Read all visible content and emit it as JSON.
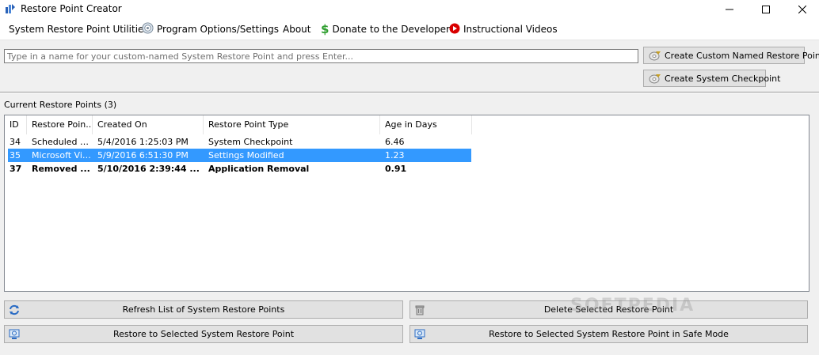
{
  "window": {
    "title": "Restore Point Creator",
    "minimize_glyph": "—",
    "maximize_glyph": "☐",
    "close_glyph": "✕"
  },
  "menu": {
    "items": [
      {
        "label": "System Restore Point Utilities",
        "icon": ""
      },
      {
        "label": "Program Options/Settings",
        "icon": "gear-icon"
      },
      {
        "label": "About",
        "icon": ""
      },
      {
        "label": "Donate to the Developer",
        "icon": "dollar-icon"
      },
      {
        "label": "Instructional Videos",
        "icon": "play-icon"
      }
    ]
  },
  "create": {
    "input_placeholder": "Type in a name for your custom-named System Restore Point and press Enter...",
    "input_value": "",
    "custom_button": "Create Custom Named Restore Point",
    "checkpoint_button": "Create System Checkpoint"
  },
  "restore_points": {
    "label": "Current Restore Points (3)",
    "columns": [
      "ID",
      "Restore Poin...",
      "Created On",
      "Restore Point Type",
      "Age in Days"
    ],
    "rows": [
      {
        "id": "34",
        "name": "Scheduled C...",
        "created": "5/4/2016 1:25:03 PM",
        "type": "System Checkpoint",
        "age": "6.46",
        "selected": false,
        "bold": false
      },
      {
        "id": "35",
        "name": "Microsoft Vis...",
        "created": "5/9/2016 6:51:30 PM",
        "type": "Settings Modified",
        "age": "1.23",
        "selected": true,
        "bold": false
      },
      {
        "id": "37",
        "name": "Removed ...",
        "created": "5/10/2016 2:39:44 ...",
        "type": "Application Removal",
        "age": "0.91",
        "selected": false,
        "bold": true
      }
    ]
  },
  "actions": {
    "refresh": "Refresh List of System Restore Points",
    "delete": "Delete Selected Restore Point",
    "restore": "Restore to Selected System Restore Point",
    "restore_safe": "Restore to Selected System Restore Point in Safe Mode"
  },
  "watermark": "SOFTPEDIA",
  "colors": {
    "selection": "#3399ff",
    "donate_green": "#2e9e2e",
    "video_red": "#d90000"
  }
}
